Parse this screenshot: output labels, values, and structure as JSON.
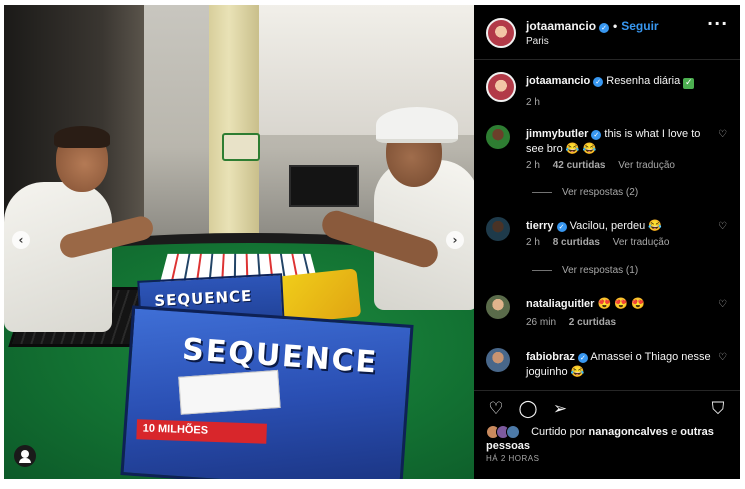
{
  "post": {
    "photo": {
      "box_back_title": "SEQUENCE",
      "box_front_title": "SEQUENCE",
      "box_banner": "10 MILHÕES"
    },
    "carousel": {
      "prev_icon": "chevron-left-icon",
      "next_icon": "chevron-right-icon"
    }
  },
  "header": {
    "username": "jotaamancio",
    "separator": "•",
    "follow_label": "Seguir",
    "location": "Paris",
    "more_label": "···"
  },
  "caption": {
    "username": "jotaamancio",
    "text": "Resenha diária",
    "time": "2 h"
  },
  "comments": [
    {
      "username": "jimmybutler",
      "text": "this is what I love to see bro 😂 😂",
      "time": "2 h",
      "likes": "42 curtidas",
      "translate": "Ver tradução",
      "replies": "Ver respostas (2)"
    },
    {
      "username": "tierry",
      "text": "Vacilou, perdeu 😂",
      "time": "2 h",
      "likes": "8 curtidas",
      "translate": "Ver tradução",
      "replies": "Ver respostas (1)"
    },
    {
      "username": "nataliaguitler",
      "text": "😍 😍 😍",
      "time": "26 min",
      "likes": "2 curtidas"
    },
    {
      "username": "fabiobraz",
      "text": "Amassei o Thiago nesse joguinho 😂"
    }
  ],
  "liked_by": {
    "prefix": "Curtido por",
    "user": "nanagoncalves",
    "middle": "e",
    "others": "outras pessoas"
  },
  "timestamp": "HÁ 2 HORAS",
  "colors": {
    "accent": "#3897f0",
    "background": "#000000",
    "muted": "#a8a8a8"
  },
  "icons": {
    "like": "heart-outline-icon",
    "comment": "comment-bubble-icon",
    "share": "paper-plane-icon",
    "save": "bookmark-icon",
    "verified": "verified-badge-icon",
    "tag": "user-tag-icon"
  }
}
